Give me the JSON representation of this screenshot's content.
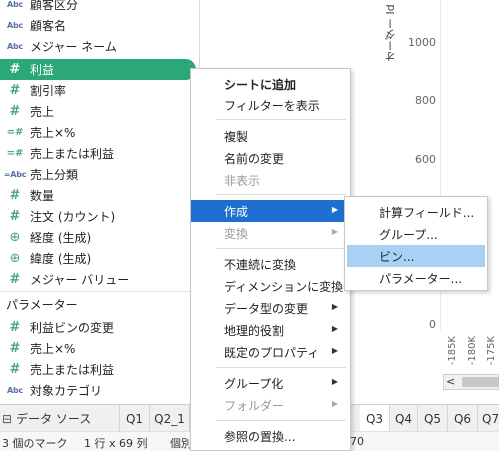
{
  "data_pane": {
    "fields": [
      {
        "icon": "Abc",
        "icon_name": "string-dimension-icon",
        "label": "顧客区分"
      },
      {
        "icon": "Abc",
        "icon_name": "string-dimension-icon",
        "label": "顧客名"
      },
      {
        "icon": "Abc",
        "icon_name": "string-dimension-icon",
        "label": "メジャー ネーム"
      },
      {
        "icon": "#",
        "icon_name": "numeric-measure-icon",
        "label": "利益"
      },
      {
        "icon": "#",
        "icon_name": "numeric-measure-icon",
        "label": "割引率"
      },
      {
        "icon": "#",
        "icon_name": "numeric-measure-icon",
        "label": "売上"
      },
      {
        "icon": "=#",
        "icon_name": "calculated-measure-icon",
        "label": "売上×%"
      },
      {
        "icon": "=#",
        "icon_name": "calculated-measure-icon",
        "label": "売上または利益"
      },
      {
        "icon": "=Abc",
        "icon_name": "calculated-string-icon",
        "label": "売上分類"
      },
      {
        "icon": "#",
        "icon_name": "numeric-measure-icon",
        "label": "数量"
      },
      {
        "icon": "#",
        "icon_name": "numeric-measure-icon",
        "label": "注文 (カウント)"
      },
      {
        "icon": "⊕",
        "icon_name": "globe-icon",
        "label": "経度 (生成)"
      },
      {
        "icon": "⊕",
        "icon_name": "globe-icon",
        "label": "緯度 (生成)"
      },
      {
        "icon": "#",
        "icon_name": "numeric-measure-icon",
        "label": "メジャー バリュー"
      }
    ],
    "selected_field": "利益",
    "parameters_header": "パラメーター",
    "parameters": [
      {
        "icon": "#",
        "icon_name": "numeric-parameter-icon",
        "label": "利益ビンの変更"
      },
      {
        "icon": "#",
        "icon_name": "numeric-parameter-icon",
        "label": "売上×%"
      },
      {
        "icon": "#",
        "icon_name": "numeric-parameter-icon",
        "label": "売上または利益"
      },
      {
        "icon": "Abc",
        "icon_name": "string-parameter-icon",
        "label": "対象カテゴリ"
      }
    ]
  },
  "chart": {
    "axis_title": "オーダー Id",
    "y_ticks": [
      "1000",
      "800",
      "600",
      "0"
    ],
    "x_ticks": [
      "-185K",
      "-180K",
      "-175K"
    ]
  },
  "context_menu": {
    "items": [
      {
        "label": "シートに追加",
        "bold": true
      },
      {
        "label": "フィルターを表示"
      },
      {
        "label": "複製"
      },
      {
        "label": "名前の変更"
      },
      {
        "label": "非表示",
        "disabled": true
      },
      {
        "label": "作成",
        "submenu": true,
        "hover": true
      },
      {
        "label": "変換",
        "submenu": true,
        "disabled": true
      },
      {
        "label": "不連続に変換"
      },
      {
        "label": "ディメンションに変換"
      },
      {
        "label": "データ型の変更",
        "submenu": true
      },
      {
        "label": "地理的役割",
        "submenu": true
      },
      {
        "label": "既定のプロパティ",
        "submenu": true
      },
      {
        "label": "グループ化",
        "submenu": true
      },
      {
        "label": "フォルダー",
        "submenu": true,
        "disabled": true
      },
      {
        "label": "参照の置換..."
      }
    ],
    "submenu_arrow": "▶"
  },
  "create_submenu": {
    "items": [
      {
        "label": "計算フィールド..."
      },
      {
        "label": "グループ..."
      },
      {
        "label": "ビン...",
        "highlight": true
      },
      {
        "label": "パラメーター..."
      }
    ]
  },
  "tabs": {
    "data_source_label": "データ ソース",
    "sheets": [
      "Q1",
      "Q2_1",
      "Q3",
      "Q4",
      "Q5",
      "Q6",
      "Q7"
    ],
    "active_sheet": "Q3"
  },
  "status_bar": {
    "marks": "3 個のマーク",
    "rows_cols": "1 行 x 69 列",
    "extra_left": "個別",
    "extra_right": "70"
  },
  "colors": {
    "selected_field_bg": "#2aa878",
    "menu_hover": "#1f6fd0",
    "submenu_highlight": "#a9d0f5"
  }
}
